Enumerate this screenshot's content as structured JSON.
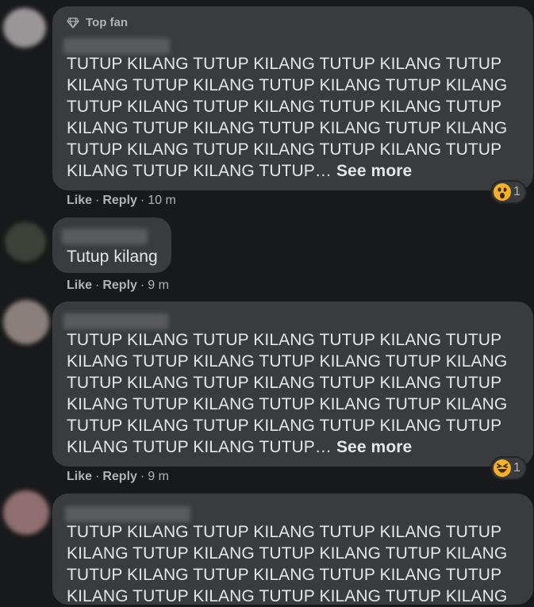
{
  "comments": [
    {
      "badge": "Top fan",
      "text": "TUTUP KILANG TUTUP KILANG TUTUP KILANG TUTUP\nKILANG TUTUP KILANG TUTUP KILANG TUTUP KILANG\nTUTUP KILANG TUTUP KILANG TUTUP KILANG TUTUP\nKILANG TUTUP KILANG TUTUP KILANG TUTUP KILANG\nTUTUP KILANG TUTUP KILANG TUTUP KILANG TUTUP\nKILANG TUTUP KILANG TUTUP…",
      "see_more": "See more",
      "like": "Like",
      "reply": "Reply",
      "time": "10 m",
      "reaction_icon": "wow-emoji",
      "reaction_count": "1"
    },
    {
      "text": "Tutup kilang",
      "like": "Like",
      "reply": "Reply",
      "time": "9 m"
    },
    {
      "text": "TUTUP KILANG TUTUP KILANG TUTUP KILANG TUTUP\nKILANG TUTUP KILANG TUTUP KILANG TUTUP KILANG\nTUTUP KILANG TUTUP KILANG TUTUP KILANG TUTUP\nKILANG TUTUP KILANG TUTUP KILANG TUTUP KILANG\nTUTUP KILANG TUTUP KILANG TUTUP KILANG TUTUP\nKILANG TUTUP KILANG TUTUP…",
      "see_more": "See more",
      "like": "Like",
      "reply": "Reply",
      "time": "9 m",
      "reaction_icon": "haha-emoji",
      "reaction_count": "1"
    },
    {
      "text": "TUTUP KILANG TUTUP KILANG TUTUP KILANG TUTUP\nKILANG TUTUP KILANG TUTUP KILANG TUTUP KILANG\nTUTUP KILANG TUTUP KILANG TUTUP KILANG TUTUP\nKILANG TUTUP KILANG TUTUP KILANG TUTUP KILANG"
    }
  ],
  "separator": "·",
  "icons": {
    "badge": "diamond-icon"
  },
  "colors": {
    "background": "#18191a",
    "bubble": "#3a3b3c",
    "text": "#e4e6eb",
    "meta": "#b0b3b8",
    "emoji": "#f7b125"
  }
}
